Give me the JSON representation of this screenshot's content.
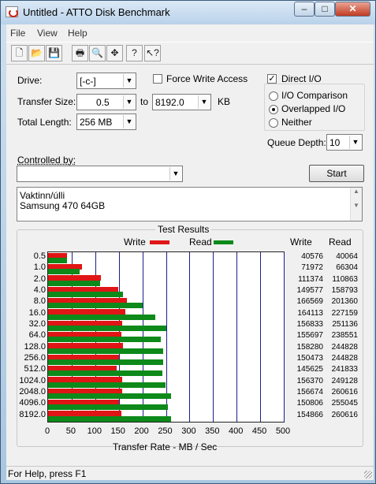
{
  "window": {
    "title": "Untitled - ATTO Disk Benchmark",
    "minimize": "–",
    "maximize": "□",
    "close": "✕"
  },
  "menu": [
    "File",
    "View",
    "Help"
  ],
  "toolbar": [
    {
      "name": "new-icon",
      "glyph": "🗋"
    },
    {
      "name": "open-icon",
      "glyph": "📂"
    },
    {
      "name": "save-icon",
      "glyph": "💾"
    },
    {
      "name": "print-icon",
      "glyph": "🖶"
    },
    {
      "name": "print-preview-icon",
      "glyph": "🔍"
    },
    {
      "name": "move-icon",
      "glyph": "✥"
    },
    {
      "name": "help-icon",
      "glyph": "?"
    },
    {
      "name": "context-help-icon",
      "glyph": "↖?"
    }
  ],
  "form": {
    "drive_label": "Drive:",
    "drive_value": "[-c-]",
    "force_write_label": "Force Write Access",
    "force_write_checked": false,
    "direct_io_label": "Direct I/O",
    "direct_io_checked": true,
    "transfer_size_label": "Transfer Size:",
    "transfer_from": "0.5",
    "to_label": "to",
    "transfer_to": "8192.0",
    "kb_label": "KB",
    "total_length_label": "Total Length:",
    "total_length": "256 MB",
    "io_comparison_label": "I/O Comparison",
    "overlapped_io_label": "Overlapped I/O",
    "neither_label": "Neither",
    "selected_io": "overlapped",
    "queue_depth_label": "Queue Depth:",
    "queue_depth": "10",
    "controlled_by_label": "Controlled by:",
    "controlled_by_value": "",
    "start_label": "Start",
    "description_lines": [
      "Vaktinn/úlli",
      "Samsung 470 64GB"
    ]
  },
  "results": {
    "title": "Test Results",
    "write_legend": "Write",
    "read_legend": "Read",
    "write_header": "Write",
    "read_header": "Read",
    "write_color": "#e01515",
    "read_color": "#0d8a1a",
    "x_axis_label": "Transfer Rate - MB / Sec"
  },
  "chart_data": {
    "type": "bar",
    "orientation": "horizontal",
    "title": "Test Results",
    "xlabel": "Transfer Rate - MB / Sec",
    "xlim": [
      0,
      500
    ],
    "xticks": [
      0,
      50,
      100,
      150,
      200,
      250,
      300,
      350,
      400,
      450,
      500
    ],
    "categories": [
      "0.5",
      "1.0",
      "2.0",
      "4.0",
      "8.0",
      "16.0",
      "32.0",
      "64.0",
      "128.0",
      "256.0",
      "512.0",
      "1024.0",
      "2048.0",
      "4096.0",
      "8192.0"
    ],
    "series": [
      {
        "name": "Write",
        "values": [
          40.6,
          72.0,
          111.4,
          149.6,
          166.6,
          164.1,
          156.8,
          155.7,
          158.3,
          150.5,
          145.6,
          156.4,
          156.7,
          150.8,
          154.9
        ],
        "raw": [
          "40576",
          "71972",
          "111374",
          "149577",
          "166569",
          "164113",
          "156833",
          "155697",
          "158280",
          "150473",
          "145625",
          "156370",
          "156674",
          "150806",
          "154866"
        ]
      },
      {
        "name": "Read",
        "values": [
          40.1,
          66.3,
          110.9,
          158.8,
          201.4,
          227.2,
          251.1,
          238.6,
          244.8,
          244.8,
          241.8,
          249.1,
          260.6,
          255.0,
          260.6
        ],
        "raw": [
          "40064",
          "66304",
          "110863",
          "158793",
          "201360",
          "227159",
          "251136",
          "238551",
          "244828",
          "244828",
          "241833",
          "249128",
          "260616",
          "255045",
          "260616"
        ]
      }
    ],
    "grid": true,
    "legend": "top"
  },
  "status": {
    "text": "For Help, press F1"
  }
}
